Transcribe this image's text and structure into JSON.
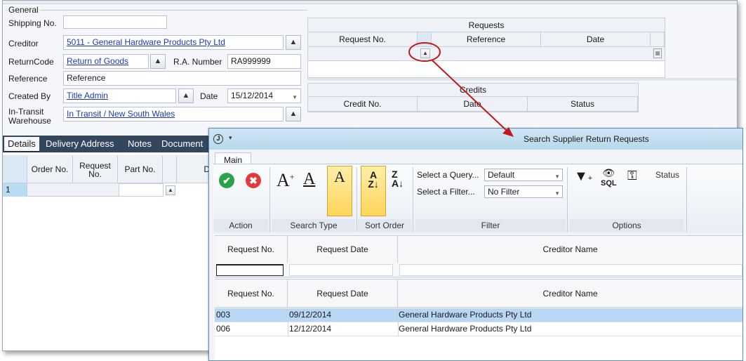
{
  "general": {
    "group_title": "General",
    "shipping_no_label": "Shipping No.",
    "creditor_label": "Creditor",
    "creditor_value": "5011 - General Hardware Products Pty Ltd",
    "return_code_label": "ReturnCode",
    "return_code_value": "Return of Goods",
    "ra_number_label": "R.A. Number",
    "ra_number_value": "RA999999",
    "reference_label": "Reference",
    "reference_value": "Reference",
    "created_by_label": "Created By",
    "created_by_value": "Title Admin",
    "date_label": "Date",
    "date_value": "15/12/2014",
    "in_transit_label_1": "In-Transit",
    "in_transit_label_2": "Warehouse",
    "in_transit_value": "In Transit / New South Wales"
  },
  "requests_grid": {
    "title": "Requests",
    "columns": [
      "Request No.",
      "Reference",
      "Date"
    ]
  },
  "credits_grid": {
    "title": "Credits",
    "columns": [
      "Credit No.",
      "Date",
      "Status"
    ]
  },
  "tabs": [
    "Details",
    "Delivery Address",
    "Notes",
    "Document"
  ],
  "details_grid": {
    "columns": [
      "Order No.",
      "Request\nNo.",
      "Part No.",
      "D"
    ],
    "row_number": "1"
  },
  "search_window": {
    "title": "Search Supplier Return Requests",
    "ribbon_tab": "Main",
    "groups": {
      "action": "Action",
      "search_type": "Search Type",
      "sort_order": "Sort Order",
      "filter": "Filter",
      "options": "Options"
    },
    "select_query_label": "Select a Query...",
    "select_query_value": "Default",
    "select_filter_label": "Select a Filter...",
    "select_filter_value": "No Filter",
    "sql_label": "SQL",
    "status_label": "Status",
    "filter_columns": [
      "Request No.",
      "Request Date",
      "Creditor Name"
    ],
    "result_columns": [
      "Request No.",
      "Request Date",
      "Creditor Name"
    ],
    "rows": [
      {
        "request_no": "003",
        "request_date": "09/12/2014",
        "creditor_name": "General Hardware Products Pty Ltd",
        "selected": true
      },
      {
        "request_no": "006",
        "request_date": "12/12/2014",
        "creditor_name": "General Hardware Products Pty Ltd",
        "selected": false
      }
    ]
  },
  "icons": {
    "up": "up-arrow-icon",
    "check": "checkmark-icon",
    "cancel": "cancel-icon",
    "annotation_color": "#c0161c",
    "selected_row_color": "#b8d7f5",
    "tab_bar_color": "#34465e"
  }
}
